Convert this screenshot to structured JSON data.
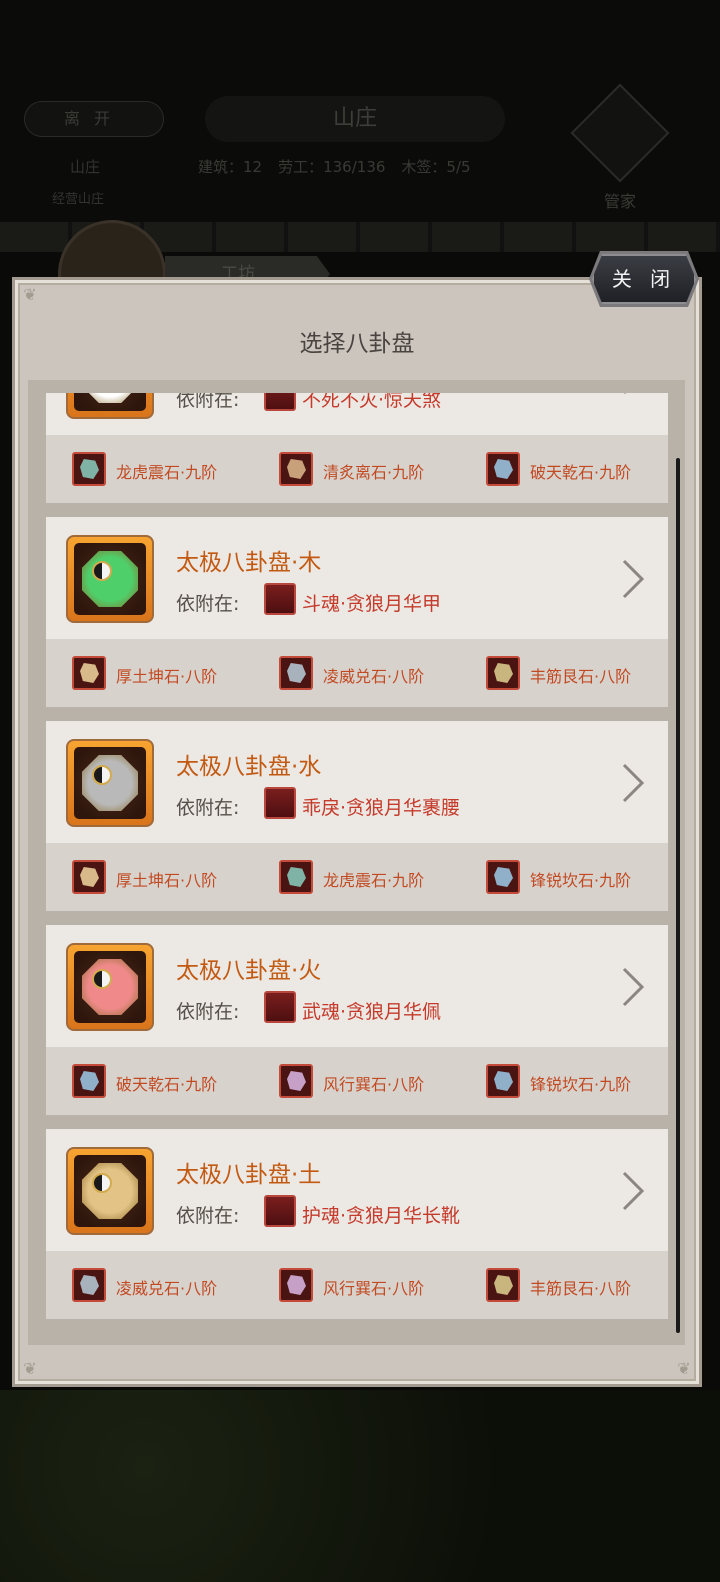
{
  "background": {
    "leave_button": "离开",
    "location_title": "山庄",
    "stats": [
      "建筑：12",
      "劳工：136/136",
      "木签：5/5"
    ],
    "butler_label": "管家",
    "side_a": "山庄",
    "side_b": "经营山庄",
    "tab_label": "工坊"
  },
  "dialog": {
    "title": "选择八卦盘",
    "close_label": "关 闭",
    "attach_prefix": "依附在:"
  },
  "cards": [
    {
      "name": "",
      "disc_color": "#ffffff",
      "equip_icon": "blade-icon",
      "equip_name": "不死不灭·惊天煞",
      "stones": [
        {
          "name": "龙虎震石·九阶",
          "gem": "#7fb3a5"
        },
        {
          "name": "清炙离石·九阶",
          "gem": "#c8a07a"
        },
        {
          "name": "破天乾石·九阶",
          "gem": "#8fb0c8"
        }
      ]
    },
    {
      "name": "太极八卦盘·木",
      "disc_color": "#4fcf6a",
      "equip_icon": "armor-icon",
      "equip_name": "斗魂·贪狼月华甲",
      "stones": [
        {
          "name": "厚土坤石·八阶",
          "gem": "#d8b98a"
        },
        {
          "name": "凌威兑石·八阶",
          "gem": "#a7b2bd"
        },
        {
          "name": "丰筋艮石·八阶",
          "gem": "#c9b57e"
        }
      ]
    },
    {
      "name": "太极八卦盘·水",
      "disc_color": "#b9b9b9",
      "equip_icon": "belt-icon",
      "equip_name": "乖戾·贪狼月华裹腰",
      "stones": [
        {
          "name": "厚土坤石·八阶",
          "gem": "#d8b98a"
        },
        {
          "name": "龙虎震石·九阶",
          "gem": "#7fb3a5"
        },
        {
          "name": "锋锐坎石·九阶",
          "gem": "#8fb0c8"
        }
      ]
    },
    {
      "name": "太极八卦盘·火",
      "disc_color": "#f08a8a",
      "equip_icon": "pendant-icon",
      "equip_name": "武魂·贪狼月华佩",
      "stones": [
        {
          "name": "破天乾石·九阶",
          "gem": "#8fb0c8"
        },
        {
          "name": "风行巽石·八阶",
          "gem": "#c7a0c7"
        },
        {
          "name": "锋锐坎石·九阶",
          "gem": "#8fb0c8"
        }
      ]
    },
    {
      "name": "太极八卦盘·土",
      "disc_color": "#e3c486",
      "equip_icon": "boot-icon",
      "equip_name": "护魂·贪狼月华长靴",
      "stones": [
        {
          "name": "凌威兑石·八阶",
          "gem": "#a7b2bd"
        },
        {
          "name": "风行巽石·八阶",
          "gem": "#c7a0c7"
        },
        {
          "name": "丰筋艮石·八阶",
          "gem": "#c9b57e"
        }
      ]
    }
  ]
}
